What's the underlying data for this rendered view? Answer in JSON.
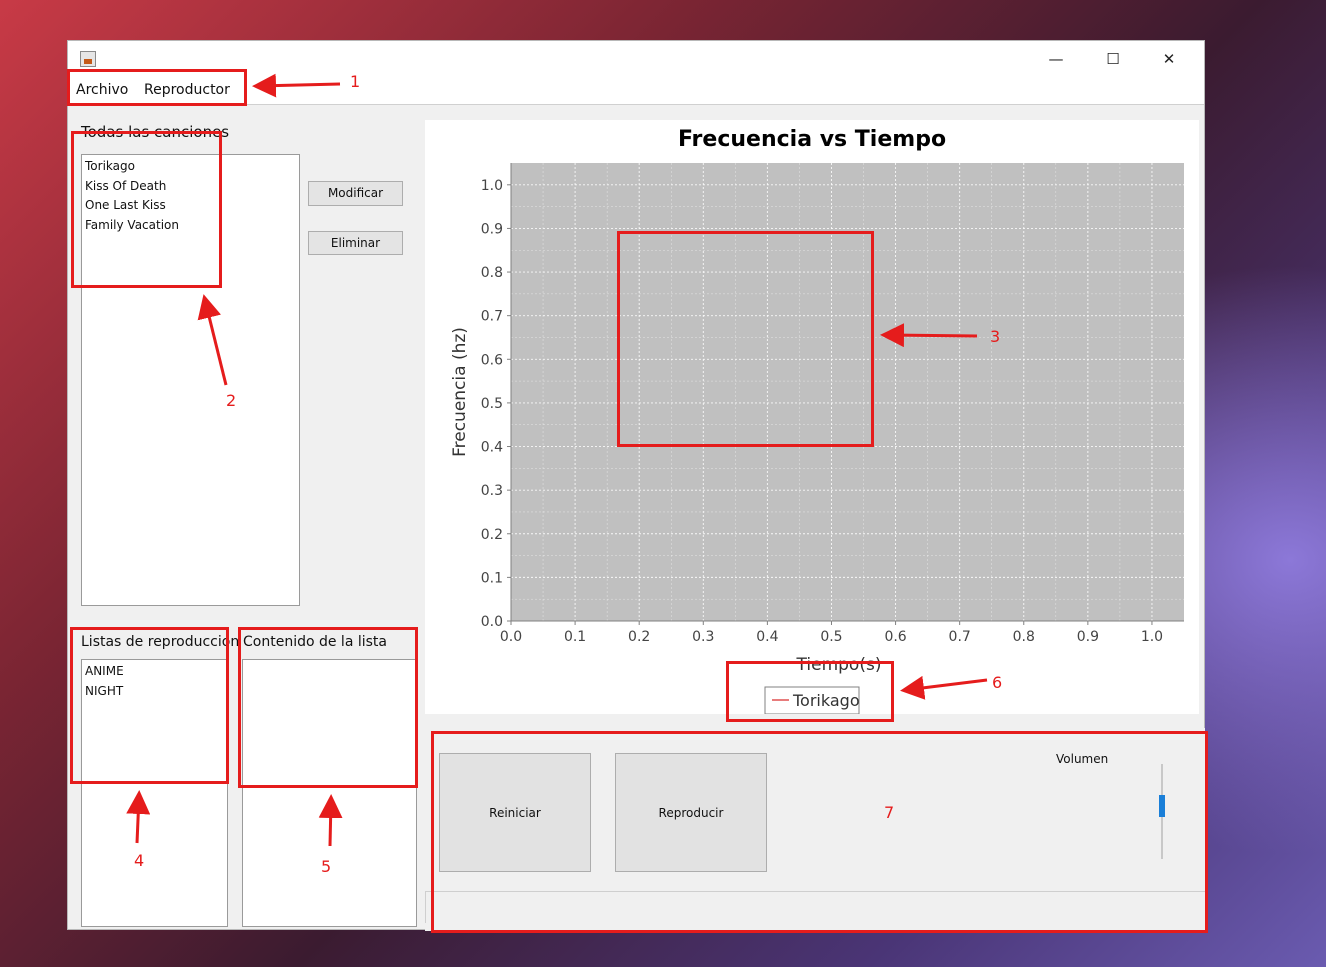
{
  "window": {
    "controls": {
      "minimize": "—",
      "maximize": "☐",
      "close": "✕"
    }
  },
  "menu": {
    "items": [
      "Archivo",
      "Reproductor"
    ]
  },
  "songs": {
    "title": "Todas las canciones",
    "items": [
      "Torikago",
      "Kiss Of Death",
      "One Last Kiss",
      "Family Vacation"
    ],
    "modify_label": "Modificar",
    "delete_label": "Eliminar"
  },
  "playlists": {
    "title": "Listas de reproduccion",
    "items": [
      "ANIME",
      "NIGHT"
    ]
  },
  "playlist_content": {
    "title": "Contenido de la lista",
    "items": []
  },
  "chart_data": {
    "type": "line",
    "title": "Frecuencia vs Tiempo",
    "xlabel": "Tiempo(s)",
    "ylabel": "Frecuencia (hz)",
    "xlim": [
      0.0,
      1.05
    ],
    "ylim": [
      0.0,
      1.05
    ],
    "xticks": [
      "0.0",
      "0.1",
      "0.2",
      "0.3",
      "0.4",
      "0.5",
      "0.6",
      "0.7",
      "0.8",
      "0.9",
      "1.0"
    ],
    "yticks": [
      "0.0",
      "0.1",
      "0.2",
      "0.3",
      "0.4",
      "0.5",
      "0.6",
      "0.7",
      "0.8",
      "0.9",
      "1.0"
    ],
    "grid": true,
    "legend_position": "bottom-center",
    "plot_background": "#c0c0c0",
    "series": [
      {
        "name": "Torikago",
        "color": "#e05050",
        "x": [],
        "y": []
      }
    ]
  },
  "controls": {
    "restart_label": "Reiniciar",
    "play_label": "Reproducir",
    "volume_label": "Volumen",
    "volume_level": 0.58
  },
  "annotations": {
    "color": "#e51c1c",
    "numbers": [
      "1",
      "2",
      "3",
      "4",
      "5",
      "6",
      "7"
    ]
  }
}
